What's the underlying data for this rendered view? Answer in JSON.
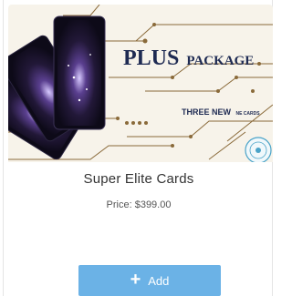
{
  "product": {
    "banner": {
      "headline_big": "PLUS",
      "headline_small": "PACKAGE",
      "sub_big": "THREE NEW",
      "sub_small": "NE CARDS",
      "colors": {
        "background": "#f7f3ea",
        "lines": "#8a6a3a",
        "headline": "#1e2a52",
        "card": "#1b1430"
      }
    },
    "name": "Super Elite Cards",
    "price_label": "Price:",
    "price_value": "$399.00",
    "add_button": {
      "label": "Add",
      "icon": "plus-icon",
      "color": "#6bb2e6"
    }
  }
}
